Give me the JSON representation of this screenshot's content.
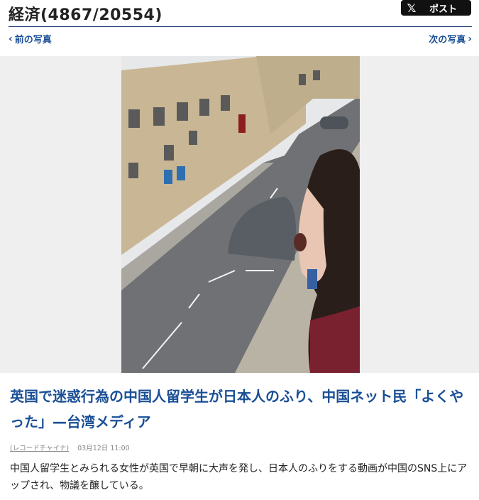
{
  "header": {
    "title": "経済(4867/20554)",
    "post_button": {
      "icon": "x-logo-icon",
      "label": "ポスト"
    }
  },
  "nav": {
    "prev_label": "前の写真",
    "next_label": "次の写真"
  },
  "photo": {
    "icon": "photo-image",
    "colors": {
      "road": "#6f7174",
      "brick": "#c9b694",
      "sky": "#e6e8ea",
      "hair": "#2a1e1a"
    }
  },
  "article": {
    "headline": "英国で迷惑行為の中国人留学生が日本人のふり、中国ネット民「よくやった」—台湾メディア",
    "source": "(レコードチャイナ)",
    "date": "03月12日 11:00",
    "summary": "中国人留学生とみられる女性が英国で早朝に大声を発し、日本人のふりをする動画が中国のSNS上にアップされ、物議を醸している。"
  },
  "colors": {
    "link": "#1a4f96",
    "divider": "#1f3d7a",
    "post_bg": "#111111"
  }
}
